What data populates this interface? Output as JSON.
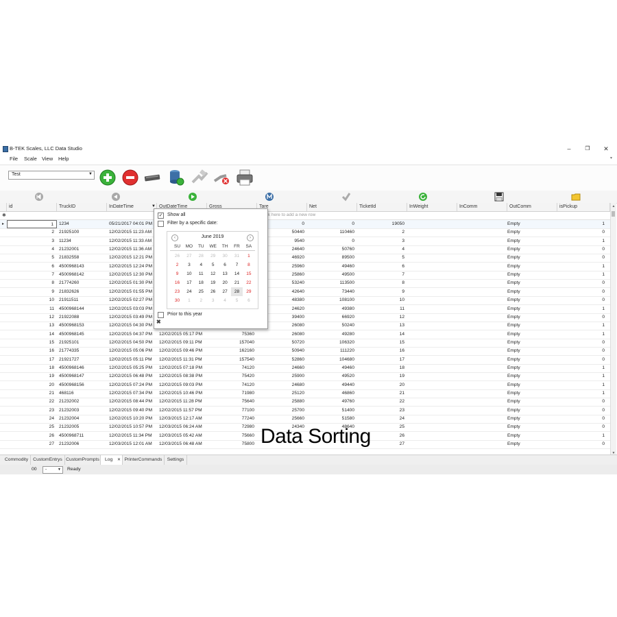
{
  "window": {
    "title": "B-TEK Scales, LLC Data Studio",
    "controls": {
      "minimize": "–",
      "maximize": "❐",
      "close": "✕"
    }
  },
  "menu": [
    "File",
    "Scale",
    "View",
    "Help"
  ],
  "toolbar": {
    "combo_value": "Test",
    "icons": [
      "add-icon",
      "remove-icon",
      "scale-device-icon",
      "database-refresh-icon",
      "connect-disabled-icon",
      "disconnect-icon",
      "printer-icon"
    ]
  },
  "nav_icons": [
    "first-record-icon",
    "previous-record-icon",
    "next-record-icon",
    "merge-icon",
    "check-icon",
    "refresh-icon",
    "save-icon",
    "folder-icon"
  ],
  "grid": {
    "columns": [
      "id",
      "TruckID",
      "InDateTime",
      "OutDateTime",
      "Gross",
      "Tare",
      "Net",
      "TicketId",
      "InWeight",
      "InComm",
      "OutComm",
      "isPickup"
    ],
    "new_row_text": "Click here to add a new row",
    "new_row_marker": "✱",
    "rows": [
      {
        "id": "1",
        "truck": "1234",
        "indt": "05/21/2017 04:01 PM",
        "outdt": "",
        "gross": "",
        "tare": "0",
        "net": "0",
        "ticket": "19050",
        "incomm": "",
        "outcomm": "Empty",
        "pickup": "1"
      },
      {
        "id": "2",
        "truck": "21925100",
        "indt": "12/02/2015 11:23 AM",
        "outdt": "",
        "gross": "",
        "tare": "50440",
        "net": "110460",
        "ticket": "2",
        "incomm": "",
        "outcomm": "Empty",
        "pickup": "0"
      },
      {
        "id": "3",
        "truck": "11234",
        "indt": "12/02/2015 11:33 AM",
        "outdt": "",
        "gross": "",
        "tare": "9540",
        "net": "0",
        "ticket": "3",
        "incomm": "",
        "outcomm": "Empty",
        "pickup": "1"
      },
      {
        "id": "4",
        "truck": "21232001",
        "indt": "12/02/2015 11:36 AM",
        "outdt": "",
        "gross": "",
        "tare": "24640",
        "net": "50760",
        "ticket": "4",
        "incomm": "",
        "outcomm": "Empty",
        "pickup": "0"
      },
      {
        "id": "5",
        "truck": "21832558",
        "indt": "12/02/2015 12:21 PM",
        "outdt": "",
        "gross": "",
        "tare": "46920",
        "net": "89500",
        "ticket": "5",
        "incomm": "",
        "outcomm": "Empty",
        "pickup": "0"
      },
      {
        "id": "6",
        "truck": "4500968143",
        "indt": "12/02/2015 12:24 PM",
        "outdt": "",
        "gross": "",
        "tare": "25960",
        "net": "49460",
        "ticket": "6",
        "incomm": "",
        "outcomm": "Empty",
        "pickup": "1"
      },
      {
        "id": "7",
        "truck": "4500968142",
        "indt": "12/02/2015 12:30 PM",
        "outdt": "",
        "gross": "",
        "tare": "25860",
        "net": "49500",
        "ticket": "7",
        "incomm": "",
        "outcomm": "Empty",
        "pickup": "1"
      },
      {
        "id": "8",
        "truck": "21774260",
        "indt": "12/02/2015 01:30 PM",
        "outdt": "",
        "gross": "",
        "tare": "53240",
        "net": "113500",
        "ticket": "8",
        "incomm": "",
        "outcomm": "Empty",
        "pickup": "0"
      },
      {
        "id": "9",
        "truck": "21832626",
        "indt": "12/02/2015 01:55 PM",
        "outdt": "",
        "gross": "",
        "tare": "42640",
        "net": "73440",
        "ticket": "9",
        "incomm": "",
        "outcomm": "Empty",
        "pickup": "0"
      },
      {
        "id": "10",
        "truck": "21911511",
        "indt": "12/02/2015 02:27 PM",
        "outdt": "",
        "gross": "",
        "tare": "48380",
        "net": "108100",
        "ticket": "10",
        "incomm": "",
        "outcomm": "Empty",
        "pickup": "0"
      },
      {
        "id": "11",
        "truck": "4500968144",
        "indt": "12/02/2015 03:03 PM",
        "outdt": "",
        "gross": "",
        "tare": "24620",
        "net": "49380",
        "ticket": "11",
        "incomm": "",
        "outcomm": "Empty",
        "pickup": "1"
      },
      {
        "id": "12",
        "truck": "21922088",
        "indt": "12/02/2015 03:49 PM",
        "outdt": "",
        "gross": "",
        "tare": "39400",
        "net": "66920",
        "ticket": "12",
        "incomm": "",
        "outcomm": "Empty",
        "pickup": "0"
      },
      {
        "id": "13",
        "truck": "4500968153",
        "indt": "12/02/2015 04:30 PM",
        "outdt": "",
        "gross": "",
        "tare": "26080",
        "net": "50240",
        "ticket": "13",
        "incomm": "",
        "outcomm": "Empty",
        "pickup": "1"
      },
      {
        "id": "14",
        "truck": "4500968145",
        "indt": "12/02/2015 04:37 PM",
        "outdt": "12/02/2015 05:17 PM",
        "gross": "75360",
        "tare": "26080",
        "net": "49280",
        "ticket": "14",
        "incomm": "",
        "outcomm": "Empty",
        "pickup": "1"
      },
      {
        "id": "15",
        "truck": "21925101",
        "indt": "12/02/2015 04:50 PM",
        "outdt": "12/02/2015 09:11 PM",
        "gross": "157040",
        "tare": "50720",
        "net": "106320",
        "ticket": "15",
        "incomm": "",
        "outcomm": "Empty",
        "pickup": "0"
      },
      {
        "id": "16",
        "truck": "21774335",
        "indt": "12/02/2015 05:06 PM",
        "outdt": "12/02/2015 09:46 PM",
        "gross": "162160",
        "tare": "50940",
        "net": "111220",
        "ticket": "16",
        "incomm": "",
        "outcomm": "Empty",
        "pickup": "0"
      },
      {
        "id": "17",
        "truck": "21921727",
        "indt": "12/02/2015 05:11 PM",
        "outdt": "12/02/2015 11:31 PM",
        "gross": "157540",
        "tare": "52860",
        "net": "104680",
        "ticket": "17",
        "incomm": "",
        "outcomm": "Empty",
        "pickup": "0"
      },
      {
        "id": "18",
        "truck": "4500968146",
        "indt": "12/02/2015 05:25 PM",
        "outdt": "12/02/2015 07:18 PM",
        "gross": "74120",
        "tare": "24660",
        "net": "49460",
        "ticket": "18",
        "incomm": "",
        "outcomm": "Empty",
        "pickup": "1"
      },
      {
        "id": "19",
        "truck": "4500968147",
        "indt": "12/02/2015 06:48 PM",
        "outdt": "12/02/2015 08:38 PM",
        "gross": "75420",
        "tare": "25900",
        "net": "49520",
        "ticket": "19",
        "incomm": "",
        "outcomm": "Empty",
        "pickup": "1"
      },
      {
        "id": "20",
        "truck": "4500968156",
        "indt": "12/02/2015 07:24 PM",
        "outdt": "12/02/2015 09:03 PM",
        "gross": "74120",
        "tare": "24680",
        "net": "49440",
        "ticket": "20",
        "incomm": "",
        "outcomm": "Empty",
        "pickup": "1"
      },
      {
        "id": "21",
        "truck": "468116",
        "indt": "12/02/2015 07:34 PM",
        "outdt": "12/02/2015 10:46 PM",
        "gross": "71980",
        "tare": "25120",
        "net": "46860",
        "ticket": "21",
        "incomm": "",
        "outcomm": "Empty",
        "pickup": "1"
      },
      {
        "id": "22",
        "truck": "21232002",
        "indt": "12/02/2015 08:44 PM",
        "outdt": "12/02/2015 11:28 PM",
        "gross": "75640",
        "tare": "25880",
        "net": "49760",
        "ticket": "22",
        "incomm": "",
        "outcomm": "Empty",
        "pickup": "0"
      },
      {
        "id": "23",
        "truck": "21232003",
        "indt": "12/02/2015 09:40 PM",
        "outdt": "12/02/2015 11:57 PM",
        "gross": "77100",
        "tare": "25700",
        "net": "51400",
        "ticket": "23",
        "incomm": "",
        "outcomm": "Empty",
        "pickup": "0"
      },
      {
        "id": "24",
        "truck": "21232004",
        "indt": "12/02/2015 10:20 PM",
        "outdt": "12/03/2015 12:17 AM",
        "gross": "77240",
        "tare": "25660",
        "net": "51580",
        "ticket": "24",
        "incomm": "",
        "outcomm": "Empty",
        "pickup": "0"
      },
      {
        "id": "25",
        "truck": "21232005",
        "indt": "12/02/2015 10:57 PM",
        "outdt": "12/03/2015 06:24 AM",
        "gross": "72980",
        "tare": "24340",
        "net": "48640",
        "ticket": "25",
        "incomm": "",
        "outcomm": "Empty",
        "pickup": "0"
      },
      {
        "id": "26",
        "truck": "4500968711",
        "indt": "12/02/2015 11:34 PM",
        "outdt": "12/03/2015 05:42 AM",
        "gross": "75660",
        "tare": "",
        "net": "",
        "ticket": "26",
        "incomm": "",
        "outcomm": "Empty",
        "pickup": "1"
      },
      {
        "id": "27",
        "truck": "21232006",
        "indt": "12/03/2015 12:01 AM",
        "outdt": "12/03/2015 06:48 AM",
        "gross": "75800",
        "tare": "",
        "net": "",
        "ticket": "27",
        "incomm": "",
        "outcomm": "Empty",
        "pickup": "0"
      }
    ]
  },
  "filter_popup": {
    "show_all": "Show all",
    "specific_date": "Filter by a specific date:",
    "prior_year": "Prior to this year",
    "close": "✖",
    "calendar": {
      "month": "June 2019",
      "prev": "‹",
      "next": "›",
      "dow": [
        "SU",
        "MO",
        "TU",
        "WE",
        "TH",
        "FR",
        "SA"
      ],
      "weeks": [
        [
          "26",
          "27",
          "28",
          "29",
          "30",
          "31",
          "1"
        ],
        [
          "2",
          "3",
          "4",
          "5",
          "6",
          "7",
          "8"
        ],
        [
          "9",
          "10",
          "11",
          "12",
          "13",
          "14",
          "15"
        ],
        [
          "16",
          "17",
          "18",
          "19",
          "20",
          "21",
          "22"
        ],
        [
          "23",
          "24",
          "25",
          "26",
          "27",
          "28",
          "29"
        ],
        [
          "30",
          "1",
          "2",
          "3",
          "4",
          "5",
          "6"
        ]
      ],
      "today": "28"
    }
  },
  "tabs": [
    "Commodity",
    "CustomEntrys",
    "CustomPrompts",
    "Log",
    "PrinterCommands",
    "Settings"
  ],
  "active_tab": "Log",
  "tab_close": "✕",
  "status": {
    "left": "00",
    "combo": "-",
    "text": "Ready"
  },
  "caption": "Data Sorting"
}
